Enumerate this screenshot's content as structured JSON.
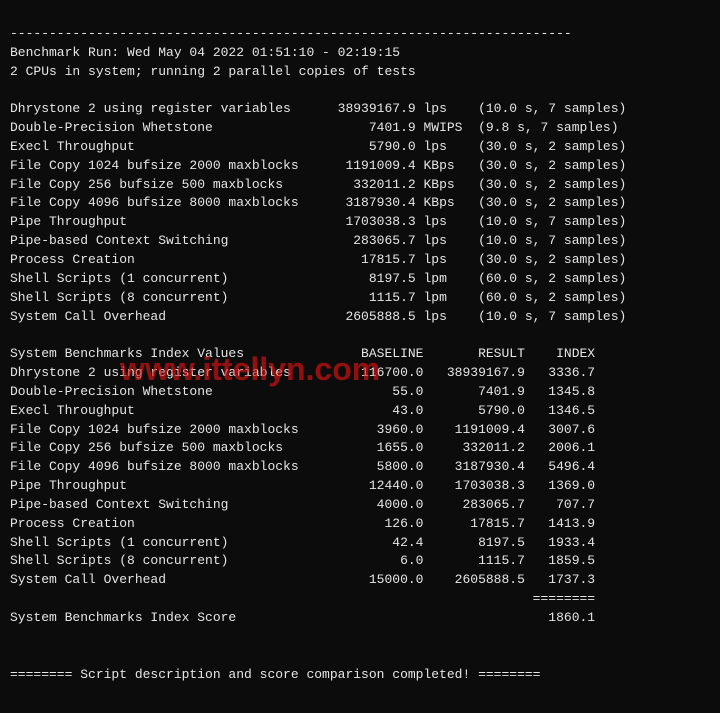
{
  "header": {
    "dash_line_top": "------------------------------------------------------------------------",
    "run_line": "Benchmark Run: Wed May 04 2022 01:51:10 - 02:19:15",
    "cpu_line": "2 CPUs in system; running 2 parallel copies of tests"
  },
  "watermark": "www.ittellyn.com",
  "raw_results": [
    {
      "name": "Dhrystone 2 using register variables",
      "value": "38939167.9",
      "unit": "lps",
      "extra": "(10.0 s, 7 samples)"
    },
    {
      "name": "Double-Precision Whetstone",
      "value": "7401.9",
      "unit": "MWIPS",
      "extra": "(9.8 s, 7 samples)"
    },
    {
      "name": "Execl Throughput",
      "value": "5790.0",
      "unit": "lps",
      "extra": "(30.0 s, 2 samples)"
    },
    {
      "name": "File Copy 1024 bufsize 2000 maxblocks",
      "value": "1191009.4",
      "unit": "KBps",
      "extra": "(30.0 s, 2 samples)"
    },
    {
      "name": "File Copy 256 bufsize 500 maxblocks",
      "value": "332011.2",
      "unit": "KBps",
      "extra": "(30.0 s, 2 samples)"
    },
    {
      "name": "File Copy 4096 bufsize 8000 maxblocks",
      "value": "3187930.4",
      "unit": "KBps",
      "extra": "(30.0 s, 2 samples)"
    },
    {
      "name": "Pipe Throughput",
      "value": "1703038.3",
      "unit": "lps",
      "extra": "(10.0 s, 7 samples)"
    },
    {
      "name": "Pipe-based Context Switching",
      "value": "283065.7",
      "unit": "lps",
      "extra": "(10.0 s, 7 samples)"
    },
    {
      "name": "Process Creation",
      "value": "17815.7",
      "unit": "lps",
      "extra": "(30.0 s, 2 samples)"
    },
    {
      "name": "Shell Scripts (1 concurrent)",
      "value": "8197.5",
      "unit": "lpm",
      "extra": "(60.0 s, 2 samples)"
    },
    {
      "name": "Shell Scripts (8 concurrent)",
      "value": "1115.7",
      "unit": "lpm",
      "extra": "(60.0 s, 2 samples)"
    },
    {
      "name": "System Call Overhead",
      "value": "2605888.5",
      "unit": "lps",
      "extra": "(10.0 s, 7 samples)"
    }
  ],
  "index_header": {
    "title": "System Benchmarks Index Values",
    "col_baseline": "BASELINE",
    "col_result": "RESULT",
    "col_index": "INDEX"
  },
  "index_results": [
    {
      "name": "Dhrystone 2 using register variables",
      "baseline": "116700.0",
      "result": "38939167.9",
      "index": "3336.7"
    },
    {
      "name": "Double-Precision Whetstone",
      "baseline": "55.0",
      "result": "7401.9",
      "index": "1345.8"
    },
    {
      "name": "Execl Throughput",
      "baseline": "43.0",
      "result": "5790.0",
      "index": "1346.5"
    },
    {
      "name": "File Copy 1024 bufsize 2000 maxblocks",
      "baseline": "3960.0",
      "result": "1191009.4",
      "index": "3007.6"
    },
    {
      "name": "File Copy 256 bufsize 500 maxblocks",
      "baseline": "1655.0",
      "result": "332011.2",
      "index": "2006.1"
    },
    {
      "name": "File Copy 4096 bufsize 8000 maxblocks",
      "baseline": "5800.0",
      "result": "3187930.4",
      "index": "5496.4"
    },
    {
      "name": "Pipe Throughput",
      "baseline": "12440.0",
      "result": "1703038.3",
      "index": "1369.0"
    },
    {
      "name": "Pipe-based Context Switching",
      "baseline": "4000.0",
      "result": "283065.7",
      "index": "707.7"
    },
    {
      "name": "Process Creation",
      "baseline": "126.0",
      "result": "17815.7",
      "index": "1413.9"
    },
    {
      "name": "Shell Scripts (1 concurrent)",
      "baseline": "42.4",
      "result": "8197.5",
      "index": "1933.4"
    },
    {
      "name": "Shell Scripts (8 concurrent)",
      "baseline": "6.0",
      "result": "1115.7",
      "index": "1859.5"
    },
    {
      "name": "System Call Overhead",
      "baseline": "15000.0",
      "result": "2605888.5",
      "index": "1737.3"
    }
  ],
  "footer": {
    "sep_line": "                                                                   ========",
    "score_label": "System Benchmarks Index Score",
    "score_value": "1860.1",
    "completed_line": "======== Script description and score comparison completed! ========"
  }
}
